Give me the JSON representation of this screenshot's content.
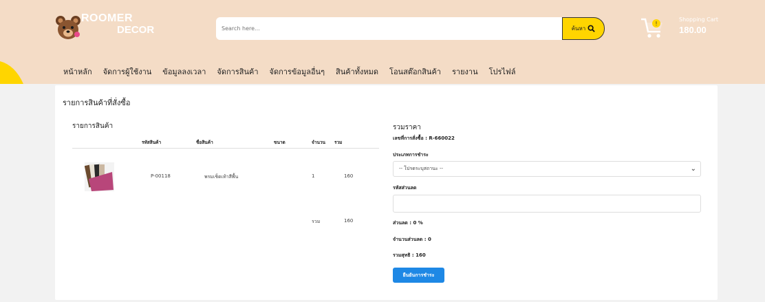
{
  "brand": {
    "line1": "ROOMER",
    "line2": "DECOR"
  },
  "search": {
    "placeholder": "Search here...",
    "button_label": "ค้นหา"
  },
  "cart": {
    "label": "Shopping Cart",
    "total": "180.00"
  },
  "nav": {
    "items": [
      "หน้าหลัก",
      "จัดการผู้ใช้งาน",
      "ข้อมูลลงเวลา",
      "จัดการสินค้า",
      "จัดการข้อมูลอื่นๆ",
      "สินค้าทั้งหมด",
      "โอนสต๊อกสินค้า",
      "รายงาน",
      "โปรไฟล์"
    ]
  },
  "page": {
    "title": "รายการสินค้าที่สั่งซื้อ"
  },
  "items_section": {
    "title": "รายการสินค้า",
    "headers": {
      "code": "รหัสสินค้า",
      "name": "ชื่อสินค้า",
      "size": "ขนาด",
      "qty": "จำนวน",
      "total": "รวม"
    },
    "rows": [
      {
        "code": "P-00118",
        "name": "พรมเช็ดเท้าสีพื้น",
        "size": "",
        "qty": "1",
        "total": "160"
      }
    ],
    "footer": {
      "label": "รวม",
      "total": "160"
    }
  },
  "summary": {
    "title": "รวมราคา",
    "order_no": "เลขที่การสั่งซื้อ : R-660022",
    "payment_type_label": "ประเภทการชำระ",
    "payment_select_value": "-- โปรดระบุสถานะ --",
    "discount_code_label": "รหัสส่วนลด",
    "discount_percent": "ส่วนลด : 0 %",
    "discount_amount": "จำนวนส่วนลด : 0",
    "net_total": "รวมสุทธิ : 160",
    "confirm_button": "ยืนยันการชำระ"
  },
  "colors": {
    "header_bg": "#f4dcc6",
    "accent": "#ffd500",
    "primary": "#1e88e5"
  }
}
